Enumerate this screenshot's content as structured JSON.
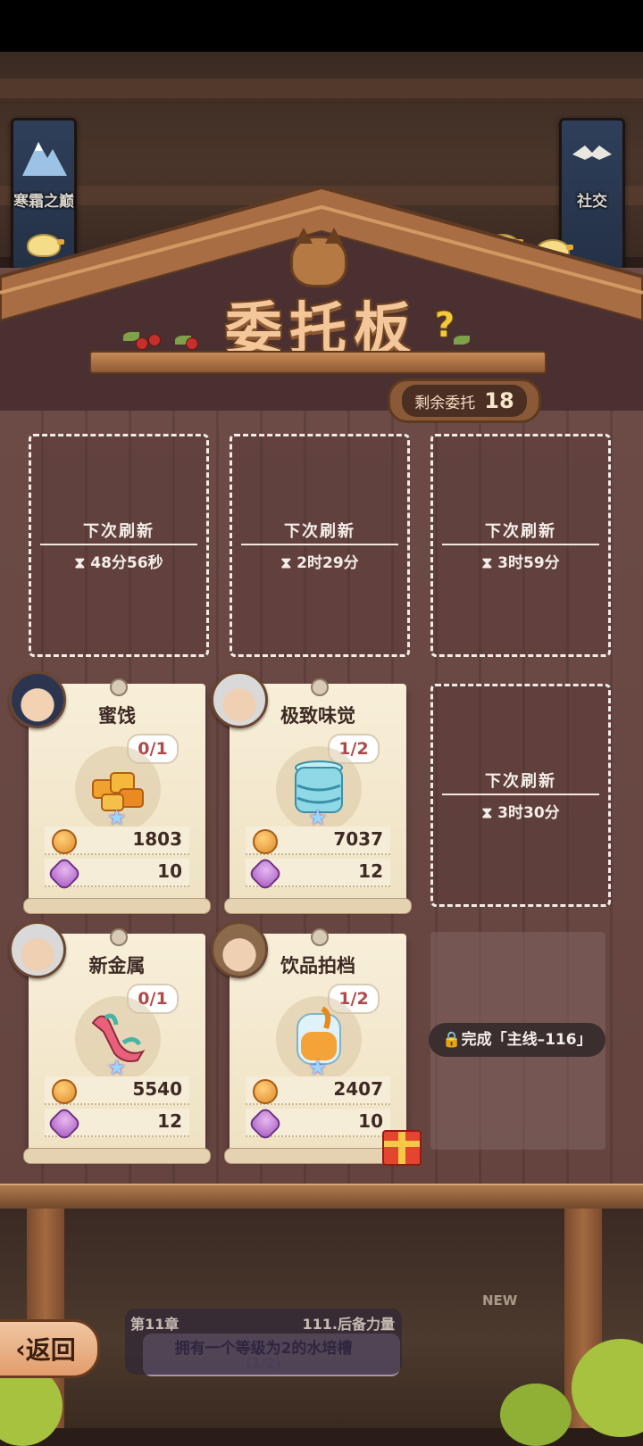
{
  "header": {
    "title": "委托板",
    "left_banner_label": "寒霜之巅",
    "right_banner_label": "社交",
    "remaining_label": "剩余委托",
    "remaining_count": "18"
  },
  "refresh_slots": [
    {
      "label": "下次刷新",
      "timer": "48分56秒"
    },
    {
      "label": "下次刷新",
      "timer": "2时29分"
    },
    {
      "label": "下次刷新",
      "timer": "3时59分"
    },
    {
      "label": "下次刷新",
      "timer": "3时30分"
    }
  ],
  "commissions": [
    {
      "name": "蜜饯",
      "progress": "0/1",
      "gold": "1803",
      "gems": "10",
      "item_icon": "candied-fruit-icon"
    },
    {
      "name": "极致味觉",
      "progress": "1/2",
      "gold": "7037",
      "gems": "12",
      "item_icon": "glass-jar-icon"
    },
    {
      "name": "新金属",
      "progress": "0/1",
      "gold": "5540",
      "gems": "12",
      "item_icon": "dragon-figure-icon"
    },
    {
      "name": "饮品拍档",
      "progress": "1/2",
      "gold": "2407",
      "gems": "10",
      "item_icon": "honey-jar-icon"
    }
  ],
  "locked_slot": {
    "text": "完成「主线–116」"
  },
  "quest": {
    "chapter": "第11章",
    "quest_title": "111.后备力量",
    "description": "拥有一个等级为2的水培槽",
    "progress": "(1/2)"
  },
  "back_button": {
    "label": "返回"
  },
  "new_badge": "NEW",
  "colors": {
    "board": "#6d4c47",
    "card": "#f8efd9",
    "accent": "#f3c79a"
  }
}
